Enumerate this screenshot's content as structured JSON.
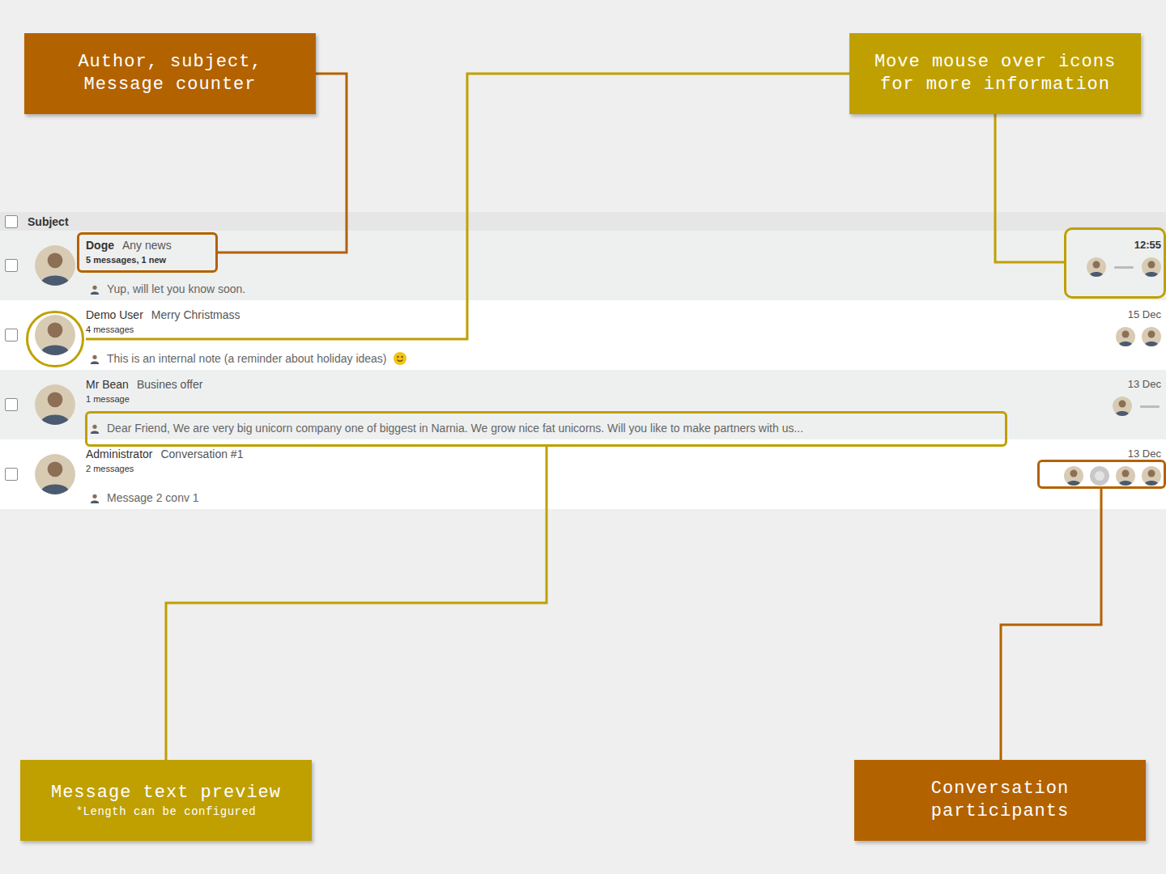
{
  "callouts": [
    {
      "lines": [
        "Author, subject,",
        "Message counter"
      ],
      "note": "",
      "color": "#b36200"
    },
    {
      "lines": [
        "Move mouse over icons",
        "for more information"
      ],
      "note": "",
      "color": "#bfa000"
    },
    {
      "lines": [
        "Message text preview"
      ],
      "note": "*Length can be configured",
      "color": "#bfa000"
    },
    {
      "lines": [
        "Conversation",
        "participants"
      ],
      "note": "",
      "color": "#b36200"
    }
  ],
  "list": {
    "header": {
      "label": "Subject",
      "checked": false
    },
    "rows": [
      {
        "author": "Doge",
        "subject": "Any news",
        "counter": "5 messages, 1 new",
        "preview": "Yup, will let you know soon.",
        "emoji": false,
        "date": "12:55",
        "unread": true,
        "checked": false,
        "participants": [
          {
            "kind": "avatar"
          },
          {
            "kind": "logo"
          },
          {
            "kind": "avatar"
          }
        ]
      },
      {
        "author": "Demo User",
        "subject": "Merry Christmass",
        "counter": "4 messages",
        "preview": "This is an internal note (a reminder about holiday ideas)",
        "emoji": true,
        "date": "15 Dec",
        "unread": false,
        "checked": false,
        "participants": [
          {
            "kind": "avatar"
          },
          {
            "kind": "avatar"
          }
        ]
      },
      {
        "author": "Mr Bean",
        "subject": "Busines offer",
        "counter": "1 message",
        "preview": "Dear Friend, We are very big unicorn company one of biggest in Narnia. We grow nice fat unicorns. Will you like to make partners with us...",
        "emoji": false,
        "date": "13 Dec",
        "unread": false,
        "checked": false,
        "participants": [
          {
            "kind": "avatar"
          },
          {
            "kind": "logo"
          }
        ]
      },
      {
        "author": "Administrator",
        "subject": "Conversation #1",
        "counter": "2 messages",
        "preview": "Message 2 conv 1",
        "emoji": false,
        "date": "13 Dec",
        "unread": false,
        "checked": false,
        "participants": [
          {
            "kind": "avatar"
          },
          {
            "kind": "placeholder"
          },
          {
            "kind": "avatar"
          },
          {
            "kind": "avatar"
          }
        ]
      }
    ]
  }
}
